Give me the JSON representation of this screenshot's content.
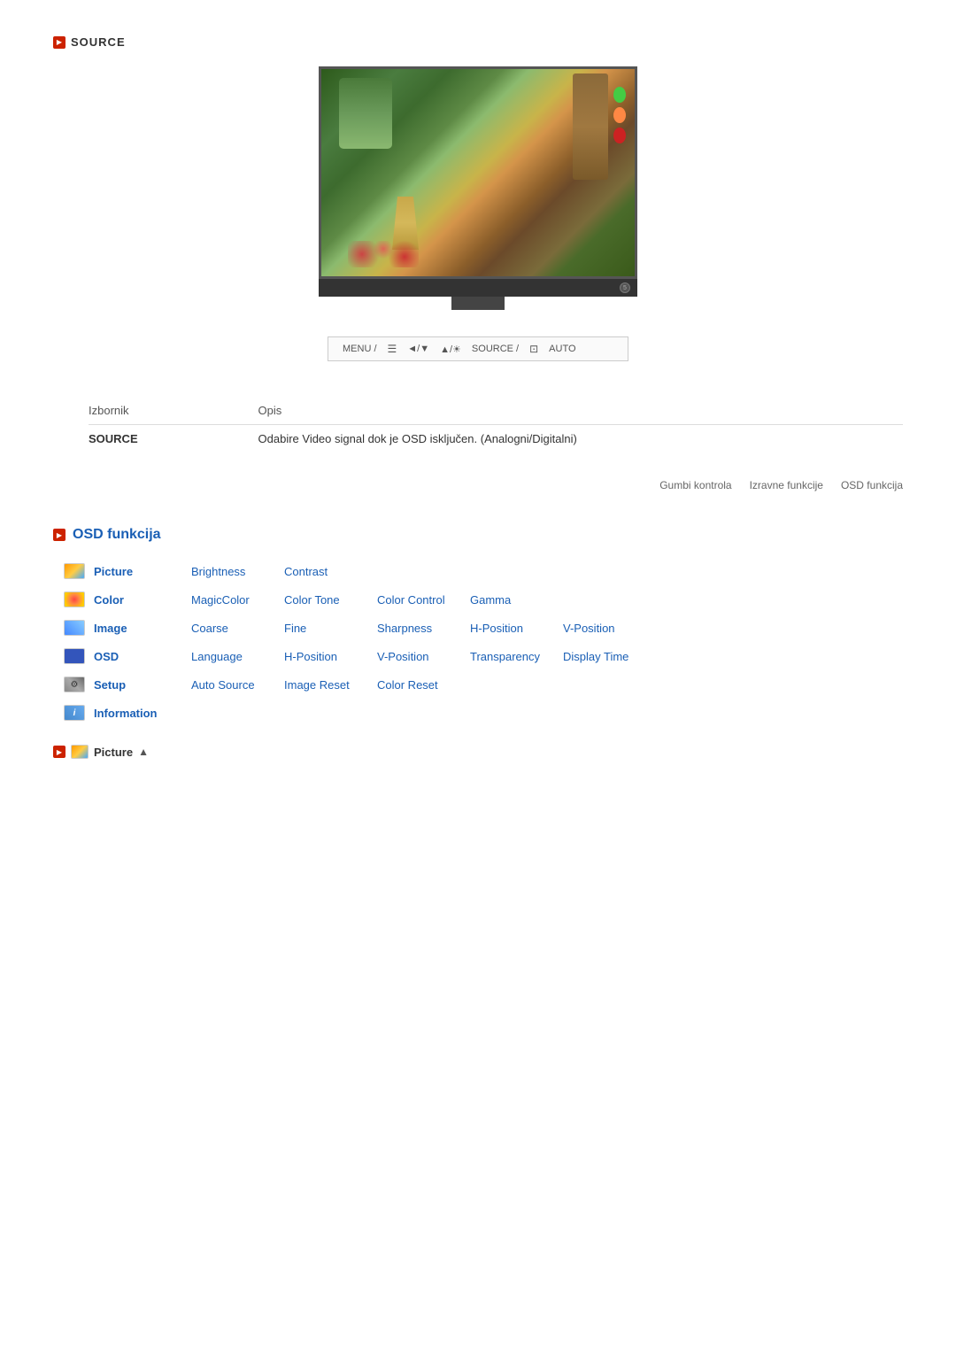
{
  "page": {
    "source_label": "SOURCE",
    "control_bar": {
      "menu": "MENU /",
      "menu_icon": "☰",
      "arrows": "◄/▼",
      "brightness": "▲/☀",
      "source": "SOURCE /",
      "source_icon": "⊡",
      "auto": "AUTO"
    },
    "table": {
      "col1_header": "Izbornik",
      "col2_header": "Opis",
      "rows": [
        {
          "label": "SOURCE",
          "description": "Odabire Video signal dok je OSD isključen. (Analogni/Digitalni)"
        }
      ]
    },
    "nav_links": [
      "Gumbi kontrola",
      "Izravne funkcije",
      "OSD funkcija"
    ],
    "osd": {
      "title": "OSD funkcija",
      "menu_rows": [
        {
          "category": "Picture",
          "icon_type": "picture",
          "items": [
            "Brightness",
            "Contrast"
          ]
        },
        {
          "category": "Color",
          "icon_type": "color",
          "items": [
            "MagicColor",
            "Color Tone",
            "Color Control",
            "Gamma"
          ]
        },
        {
          "category": "Image",
          "icon_type": "image",
          "items": [
            "Coarse",
            "Fine",
            "Sharpness",
            "H-Position",
            "V-Position"
          ]
        },
        {
          "category": "OSD",
          "icon_type": "osd",
          "items": [
            "Language",
            "H-Position",
            "V-Position",
            "Transparency",
            "Display Time"
          ]
        },
        {
          "category": "Setup",
          "icon_type": "setup",
          "items": [
            "Auto Source",
            "Image Reset",
            "Color Reset"
          ]
        },
        {
          "category": "Information",
          "icon_type": "info",
          "items": []
        }
      ],
      "picture_nav_label": "Picture",
      "picture_nav_up": "▲"
    }
  }
}
